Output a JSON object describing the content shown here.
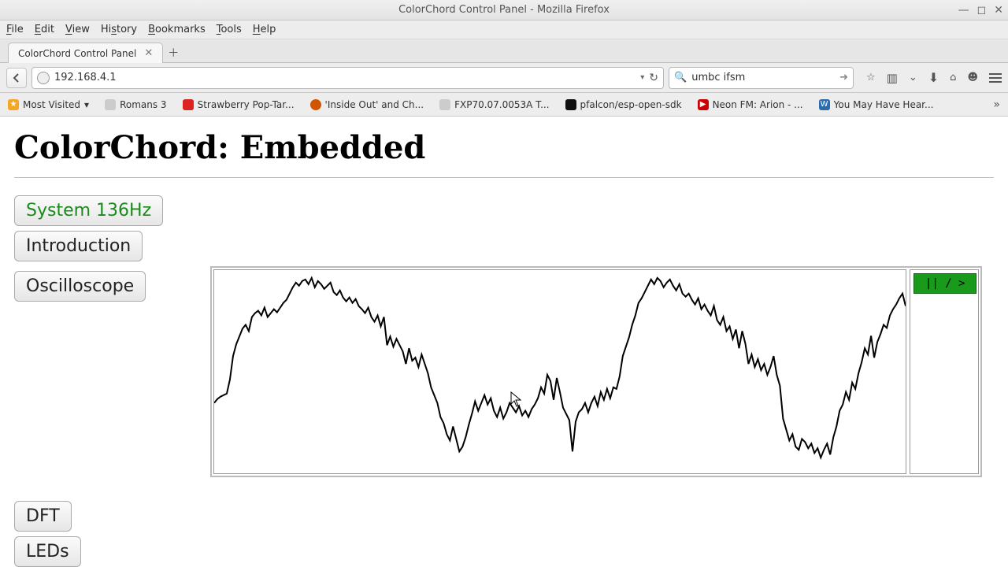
{
  "window": {
    "title": "ColorChord Control Panel - Mozilla Firefox"
  },
  "menubar": {
    "items": [
      "File",
      "Edit",
      "View",
      "History",
      "Bookmarks",
      "Tools",
      "Help"
    ]
  },
  "tab": {
    "title": "ColorChord Control Panel"
  },
  "nav": {
    "url": "192.168.4.1",
    "search_value": "umbc ifsm"
  },
  "bookmarks": {
    "most_visited": "Most Visited",
    "items": [
      {
        "label": "Romans 3",
        "color": "#ccc"
      },
      {
        "label": "Strawberry Pop-Tar...",
        "color": "#d22"
      },
      {
        "label": "'Inside Out' and Ch...",
        "color": "#d35400"
      },
      {
        "label": "FXP70.07.0053A T...",
        "color": "#ccc"
      },
      {
        "label": "pfalcon/esp-open-sdk",
        "color": "#111"
      },
      {
        "label": "Neon FM: Arion - ...",
        "color": "#cc0000"
      },
      {
        "label": "You May Have Hear...",
        "color": "#2b6cb0"
      }
    ]
  },
  "page": {
    "title": "ColorChord: Embedded",
    "buttons": {
      "system": "System 136Hz",
      "intro": "Introduction",
      "scope": "Oscilloscope",
      "dft": "DFT",
      "leds": "LEDs"
    },
    "play_pause": "|| / >"
  },
  "chart_data": {
    "type": "line",
    "title": "Oscilloscope",
    "xlabel": "",
    "ylabel": "",
    "xlim": [
      0,
      880
    ],
    "ylim": [
      0,
      260
    ],
    "x": [
      0,
      4,
      8,
      12,
      16,
      20,
      24,
      28,
      32,
      36,
      40,
      44,
      48,
      52,
      56,
      60,
      64,
      68,
      72,
      76,
      80,
      84,
      88,
      92,
      96,
      100,
      104,
      108,
      112,
      116,
      120,
      124,
      128,
      132,
      136,
      140,
      144,
      148,
      152,
      156,
      160,
      164,
      168,
      172,
      176,
      180,
      184,
      188,
      192,
      196,
      200,
      204,
      208,
      212,
      216,
      220,
      224,
      228,
      232,
      236,
      240,
      244,
      248,
      252,
      256,
      260,
      264,
      268,
      272,
      276,
      280,
      284,
      288,
      292,
      296,
      300,
      304,
      308,
      312,
      316,
      320,
      324,
      328,
      332,
      336,
      340,
      344,
      348,
      352,
      356,
      360,
      364,
      368,
      372,
      376,
      380,
      384,
      388,
      392,
      396,
      400,
      404,
      408,
      412,
      416,
      420,
      424,
      428,
      432,
      436,
      440,
      444,
      448,
      452,
      456,
      460,
      464,
      468,
      472,
      476,
      480,
      484,
      488,
      492,
      496,
      500,
      504,
      508,
      512,
      516,
      520,
      524,
      528,
      532,
      536,
      540,
      544,
      548,
      552,
      556,
      560,
      564,
      568,
      572,
      576,
      580,
      584,
      588,
      592,
      596,
      600,
      604,
      608,
      612,
      616,
      620,
      624,
      628,
      632,
      636,
      640,
      644,
      648,
      652,
      656,
      660,
      664,
      668,
      672,
      676,
      680,
      684,
      688,
      692,
      696,
      700,
      704,
      708,
      712,
      716,
      720,
      724,
      728,
      732,
      736,
      740,
      744,
      748,
      752,
      756,
      760,
      764,
      768,
      772,
      776,
      780,
      784,
      788,
      792,
      796,
      800,
      804,
      808,
      812,
      816,
      820,
      824,
      828,
      832,
      836,
      840,
      844,
      848,
      852,
      856,
      860,
      864,
      868,
      872,
      876,
      880
    ],
    "y": [
      170,
      165,
      162,
      160,
      158,
      140,
      110,
      95,
      85,
      75,
      70,
      78,
      60,
      55,
      52,
      58,
      48,
      60,
      55,
      50,
      54,
      48,
      42,
      38,
      30,
      22,
      16,
      20,
      14,
      12,
      18,
      10,
      22,
      14,
      18,
      24,
      20,
      16,
      28,
      32,
      26,
      35,
      40,
      35,
      42,
      37,
      46,
      50,
      55,
      48,
      60,
      66,
      58,
      72,
      60,
      96,
      85,
      98,
      88,
      96,
      104,
      120,
      100,
      116,
      112,
      124,
      108,
      120,
      132,
      150,
      160,
      170,
      188,
      196,
      210,
      218,
      200,
      216,
      232,
      226,
      214,
      198,
      184,
      168,
      180,
      170,
      160,
      172,
      164,
      180,
      188,
      176,
      190,
      182,
      170,
      176,
      182,
      174,
      186,
      180,
      188,
      178,
      172,
      164,
      150,
      158,
      134,
      142,
      166,
      138,
      156,
      176,
      184,
      192,
      232,
      194,
      182,
      178,
      170,
      182,
      170,
      162,
      174,
      156,
      166,
      152,
      164,
      150,
      152,
      136,
      110,
      98,
      86,
      70,
      58,
      42,
      36,
      28,
      20,
      12,
      18,
      10,
      14,
      22,
      16,
      12,
      20,
      26,
      18,
      30,
      34,
      30,
      38,
      44,
      36,
      50,
      44,
      52,
      58,
      46,
      64,
      70,
      60,
      78,
      72,
      88,
      76,
      100,
      78,
      94,
      120,
      108,
      124,
      114,
      128,
      120,
      134,
      124,
      110,
      134,
      148,
      190,
      204,
      218,
      210,
      226,
      230,
      216,
      220,
      228,
      222,
      234,
      228,
      240,
      230,
      222,
      236,
      214,
      200,
      180,
      172,
      156,
      166,
      144,
      152,
      132,
      118,
      100,
      108,
      84,
      112,
      92,
      82,
      70,
      74,
      58,
      50,
      44,
      36,
      30,
      46
    ]
  }
}
